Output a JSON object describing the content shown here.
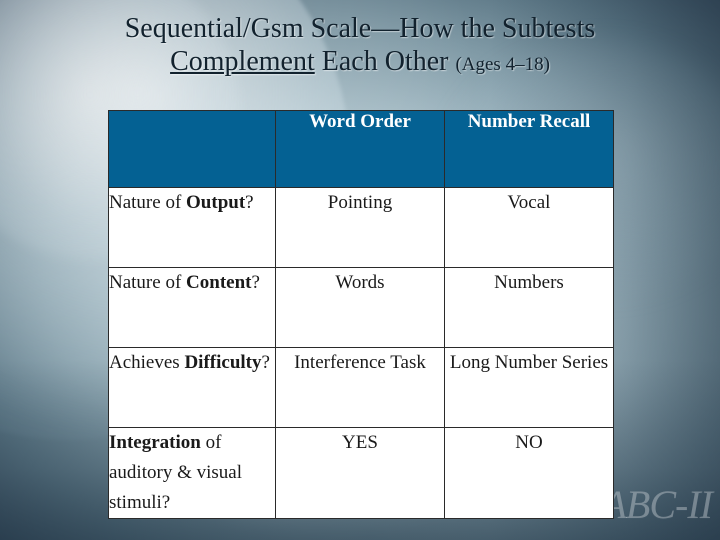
{
  "slide": {
    "title_line1": "Sequential/Gsm Scale—How the Subtests",
    "title_line2_underlined": "Complement",
    "title_line2_rest": " Each Other ",
    "title_ages": "(Ages 4–18)",
    "watermark": "KABC-II",
    "accent_color": "#046193"
  },
  "table": {
    "headers": [
      "",
      "Word Order",
      "Number Recall"
    ],
    "rows": [
      {
        "label_bold_first": false,
        "label_plain": "Nature of ",
        "label_bold": "Output",
        "label_tail": "?",
        "word_order": "Pointing",
        "number_recall": "Vocal"
      },
      {
        "label_bold_first": false,
        "label_plain": "Nature of ",
        "label_bold": "Content",
        "label_tail": "?",
        "word_order": "Words",
        "number_recall": "Numbers"
      },
      {
        "label_bold_first": false,
        "label_plain": "Achieves ",
        "label_bold": "Difficulty",
        "label_tail": "?",
        "word_order": "Interference Task",
        "number_recall": "Long Number Series"
      },
      {
        "label_bold_first": true,
        "label_bold": "Integration",
        "label_plain": " of auditory & visual stimuli?",
        "label_tail": "",
        "word_order": "YES",
        "number_recall": "NO"
      }
    ]
  }
}
